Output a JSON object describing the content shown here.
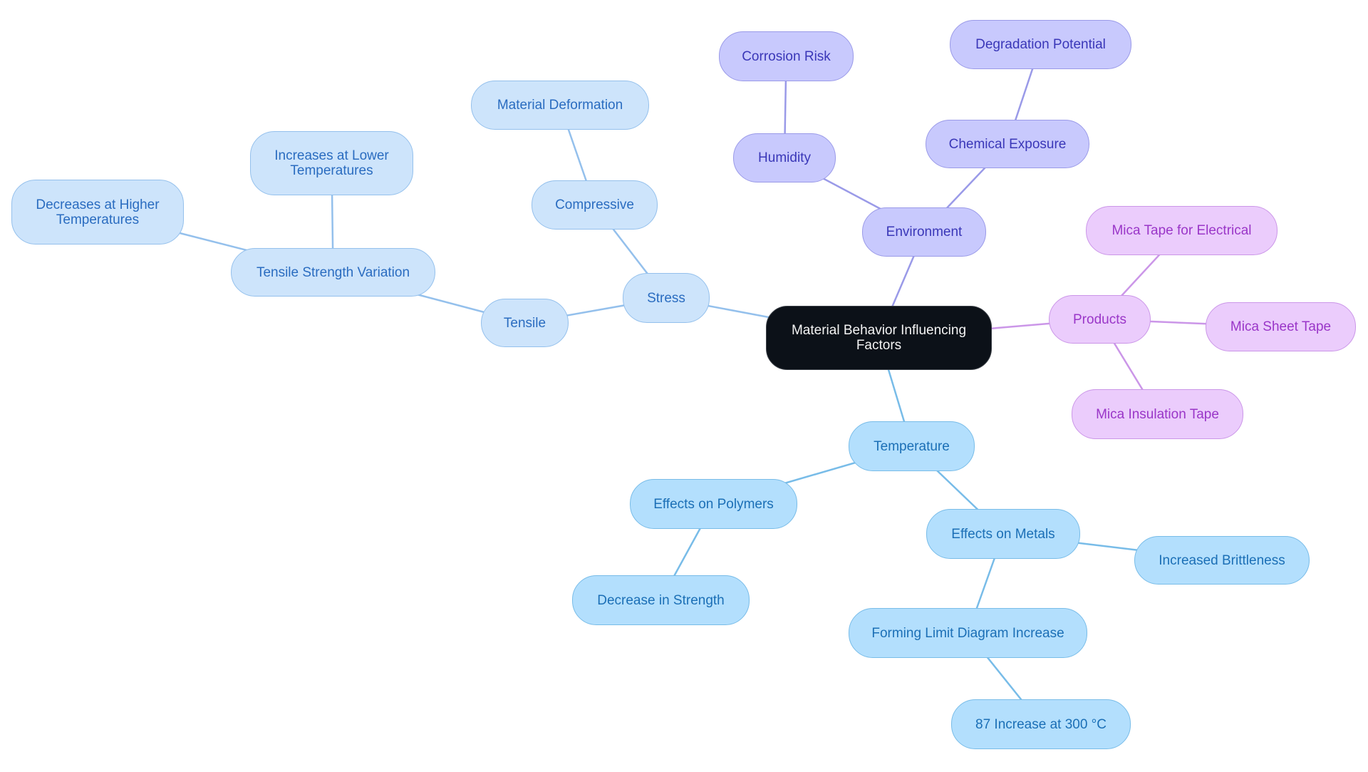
{
  "diagram": {
    "type": "mindmap",
    "root": "Material Behavior Influencing Factors",
    "colors": {
      "root": "#0c1118",
      "stress_branch": "#cde4fb",
      "environment_branch": "#c8c9fd",
      "products_branch": "#ebccfc",
      "temperature_branch": "#b3dffd"
    },
    "nodes": {
      "root": "Material Behavior Influencing Factors",
      "stress": "Stress",
      "tensile": "Tensile",
      "tensile_strength_variation": "Tensile Strength Variation",
      "decreases_higher": "Decreases at Higher Temperatures",
      "increases_lower": "Increases at Lower Temperatures",
      "compressive": "Compressive",
      "material_deformation": "Material Deformation",
      "environment": "Environment",
      "humidity": "Humidity",
      "corrosion_risk": "Corrosion Risk",
      "chemical_exposure": "Chemical Exposure",
      "degradation_potential": "Degradation Potential",
      "products": "Products",
      "mica_tape_electrical": "Mica Tape for Electrical",
      "mica_sheet_tape": "Mica Sheet Tape",
      "mica_insulation_tape": "Mica Insulation Tape",
      "temperature": "Temperature",
      "effects_polymers": "Effects on Polymers",
      "decrease_strength": "Decrease in Strength",
      "effects_metals": "Effects on Metals",
      "increased_brittleness": "Increased Brittleness",
      "forming_limit": "Forming Limit Diagram Increase",
      "increase_300": "87 Increase at 300 °C"
    },
    "edges": [
      [
        "root",
        "stress"
      ],
      [
        "stress",
        "tensile"
      ],
      [
        "tensile",
        "tensile_strength_variation"
      ],
      [
        "tensile_strength_variation",
        "decreases_higher"
      ],
      [
        "tensile_strength_variation",
        "increases_lower"
      ],
      [
        "stress",
        "compressive"
      ],
      [
        "compressive",
        "material_deformation"
      ],
      [
        "root",
        "environment"
      ],
      [
        "environment",
        "humidity"
      ],
      [
        "humidity",
        "corrosion_risk"
      ],
      [
        "environment",
        "chemical_exposure"
      ],
      [
        "chemical_exposure",
        "degradation_potential"
      ],
      [
        "root",
        "products"
      ],
      [
        "products",
        "mica_tape_electrical"
      ],
      [
        "products",
        "mica_sheet_tape"
      ],
      [
        "products",
        "mica_insulation_tape"
      ],
      [
        "root",
        "temperature"
      ],
      [
        "temperature",
        "effects_polymers"
      ],
      [
        "effects_polymers",
        "decrease_strength"
      ],
      [
        "temperature",
        "effects_metals"
      ],
      [
        "effects_metals",
        "increased_brittleness"
      ],
      [
        "effects_metals",
        "forming_limit"
      ],
      [
        "forming_limit",
        "increase_300"
      ]
    ]
  }
}
